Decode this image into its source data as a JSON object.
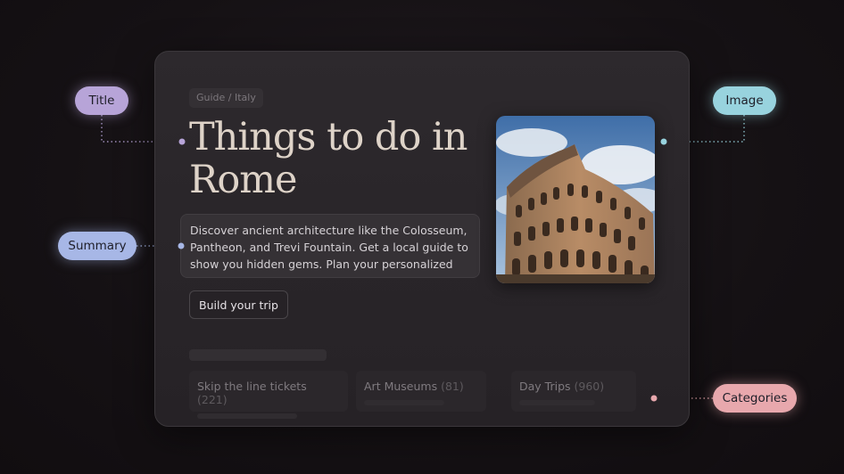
{
  "breadcrumb": "Guide / Italy",
  "title": "Things to do in Rome",
  "summary": "Discover ancient architecture like the Colosseum, Pantheon, and Trevi Fountain. Get a local guide to show you hidden gems. Plan your personalized R...",
  "build_button": "Build your trip",
  "categories": [
    {
      "label": "Skip the line tickets",
      "count": "(221)"
    },
    {
      "label": "Art Museums",
      "count": "(81)"
    },
    {
      "label": "Day Trips",
      "count": "(960)"
    }
  ],
  "annotations": {
    "title": "Title",
    "summary": "Summary",
    "image": "Image",
    "categories": "Categories"
  },
  "colors": {
    "title_pill": "#b7a4d8",
    "summary_pill": "#a7b7e6",
    "image_pill": "#98d3de",
    "categories_pill": "#e8a8ad",
    "heading_text": "#ded3c8"
  },
  "icons": {
    "photo": "colosseum-photo"
  }
}
